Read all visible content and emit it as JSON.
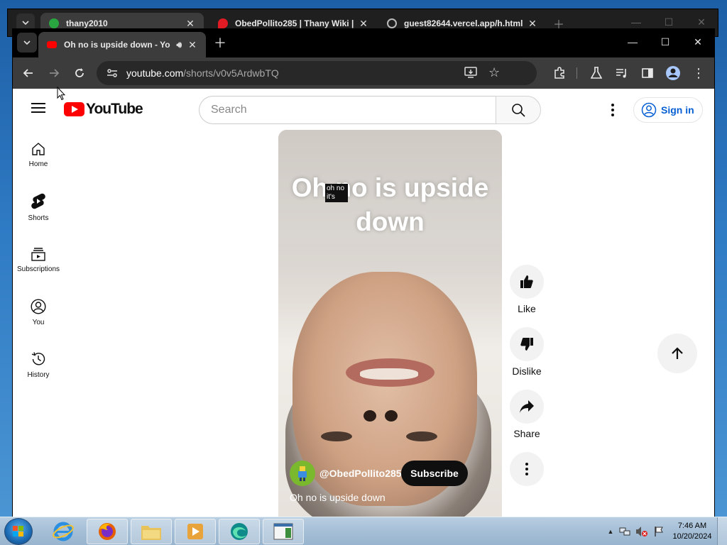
{
  "back_window": {
    "tabs": [
      {
        "title": "thany2010",
        "active": true,
        "favicon_color": "#2aa640"
      },
      {
        "title": "ObedPollito285 | Thany Wiki |",
        "active": false,
        "favicon_color": "#e01b24"
      },
      {
        "title": "guest82644.vercel.app/h.html",
        "active": false,
        "favicon_color": "#bbbbbb"
      }
    ]
  },
  "browser": {
    "tab": {
      "title": "Oh no is upside down - Yo",
      "favicon_color": "#ff0000"
    },
    "url_host": "youtube.com",
    "url_path": "/shorts/v0v5ArdwbTQ"
  },
  "youtube": {
    "logo_text": "YouTube",
    "search_placeholder": "Search",
    "signin_label": "Sign in",
    "guide": [
      {
        "label": "Home",
        "icon": "home-icon"
      },
      {
        "label": "Shorts",
        "icon": "shorts-icon"
      },
      {
        "label": "Subscriptions",
        "icon": "subscriptions-icon"
      },
      {
        "label": "You",
        "icon": "you-icon"
      },
      {
        "label": "History",
        "icon": "history-icon"
      }
    ],
    "short": {
      "caption": "Oh no is upside down",
      "sticker_text": "oh no it's",
      "channel_handle": "@ObedPollito285",
      "subscribe_label": "Subscribe",
      "title": "Oh no is upside down"
    },
    "actions": {
      "like": "Like",
      "dislike": "Dislike",
      "share": "Share"
    }
  },
  "taskbar": {
    "time": "7:46 AM",
    "date": "10/20/2024"
  }
}
